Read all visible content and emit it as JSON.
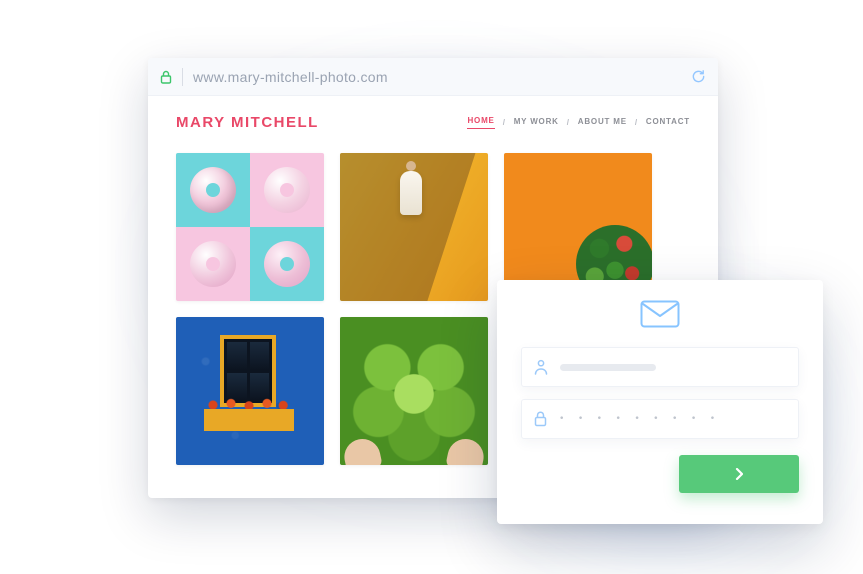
{
  "browser": {
    "url": "www.mary-mitchell-photo.com",
    "secure": true
  },
  "site": {
    "brand": "MARY MITCHELL",
    "nav": {
      "home": "HOME",
      "work": "MY WORK",
      "about": "ABOUT ME",
      "contact": "CONTACT",
      "separator": "/"
    },
    "active_nav": "home",
    "accent_color": "#e94868"
  },
  "gallery": {
    "tiles": [
      {
        "name": "donuts-photo"
      },
      {
        "name": "yellow-architecture-photo"
      },
      {
        "name": "salad-bowl-photo"
      },
      {
        "name": "blue-wall-window-photo"
      },
      {
        "name": "lettuce-photo"
      }
    ]
  },
  "login": {
    "icon": "mail-icon",
    "username_placeholder": "",
    "password_mask": "• • • • • • • • •",
    "submit_color": "#57c97a"
  }
}
